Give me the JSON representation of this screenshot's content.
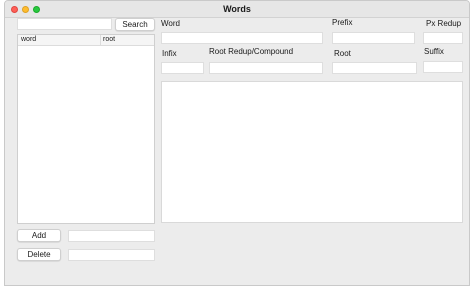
{
  "window": {
    "title": "Words"
  },
  "search": {
    "button_label": "Search",
    "value": ""
  },
  "word_list": {
    "columns": [
      "word",
      "root"
    ],
    "rows": []
  },
  "actions": {
    "add_label": "Add",
    "delete_label": "Delete",
    "add_value": "",
    "delete_value": ""
  },
  "form": {
    "word_label": "Word",
    "prefix_label": "Prefix",
    "px_redup_label": "Px Redup",
    "infix_label": "Infix",
    "root_redup_compound_label": "Root Redup/Compound",
    "root_label": "Root",
    "suffix_label": "Suffix"
  }
}
